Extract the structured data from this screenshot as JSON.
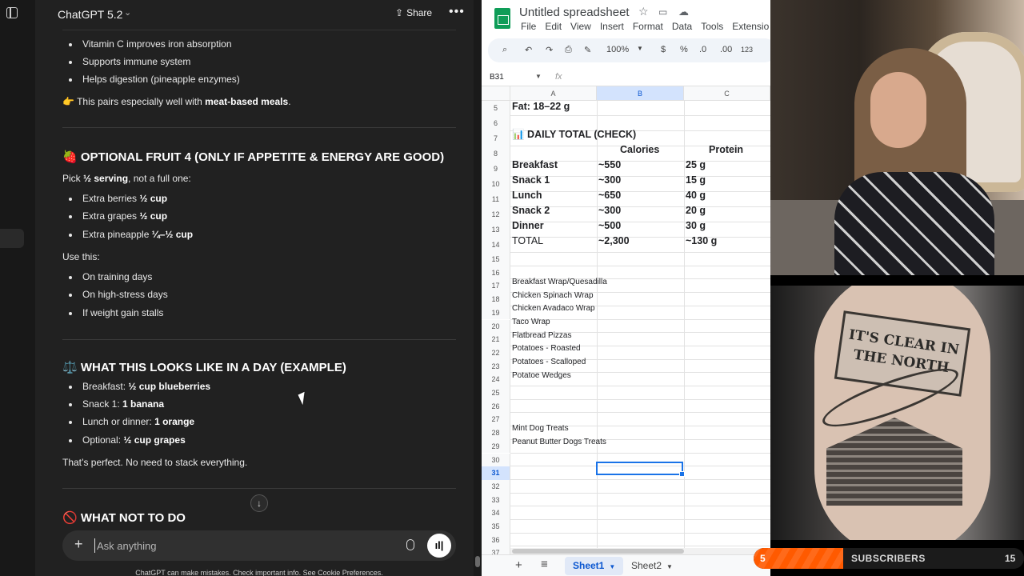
{
  "chatgpt": {
    "model": "ChatGPT 5.2",
    "share": "Share",
    "more": "•••",
    "intro_bullets": [
      "Vitamin C improves iron absorption",
      "Supports immune system",
      "Helps digestion (pineapple enzymes)"
    ],
    "tip_emoji": "👉",
    "tip_text": "This pairs especially well with ",
    "tip_bold": "meat-based meals",
    "tip_end": ".",
    "s1_emoji": "🍓",
    "s1_heading": "OPTIONAL FRUIT 4 (ONLY IF APPETITE & ENERGY ARE GOOD)",
    "s1_pick_a": "Pick ",
    "s1_pick_b": "½ serving",
    "s1_pick_c": ", not a full one:",
    "s1_items": [
      {
        "a": "Extra berries ",
        "b": "½ cup"
      },
      {
        "a": "Extra grapes ",
        "b": "½ cup"
      },
      {
        "a": "Extra pineapple ",
        "b": "¼–½ cup"
      }
    ],
    "use_this": "Use this:",
    "use_items": [
      "On training days",
      "On high-stress days",
      "If weight gain stalls"
    ],
    "s2_emoji": "⚖️",
    "s2_heading": "WHAT THIS LOOKS LIKE IN A DAY (EXAMPLE)",
    "s2_items": [
      {
        "a": "Breakfast: ",
        "b": "½ cup blueberries"
      },
      {
        "a": "Snack 1: ",
        "b": "1 banana"
      },
      {
        "a": "Lunch or dinner: ",
        "b": "1 orange"
      },
      {
        "a": "Optional: ",
        "b": "½ cup grapes"
      }
    ],
    "perfect": "That’s perfect. No need to stack everything.",
    "s3_emoji": "🚫",
    "s3_heading": "WHAT NOT TO DO",
    "input_placeholder": "Ask anything",
    "disclaimer": "ChatGPT can make mistakes. Check important info. See Cookie Preferences."
  },
  "sheets": {
    "title": "Untitled spreadsheet",
    "menu": [
      "File",
      "Edit",
      "View",
      "Insert",
      "Format",
      "Data",
      "Tools",
      "Extensio"
    ],
    "zoom": "100%",
    "currency": "$",
    "percent": "%",
    "dec_less": ".0",
    "dec_more": ".00",
    "num_fmt": "123",
    "name_box": "B31",
    "fx": "fx",
    "columns": [
      "A",
      "B",
      "C"
    ],
    "rows": [
      "5",
      "6",
      "7",
      "8",
      "9",
      "10",
      "11",
      "12",
      "13",
      "14",
      "15",
      "16",
      "17",
      "18",
      "19",
      "20",
      "21",
      "22",
      "23",
      "24",
      "25",
      "26",
      "27",
      "28",
      "29",
      "30",
      "31",
      "32",
      "33",
      "34",
      "35",
      "36",
      "37"
    ],
    "fat": "Fat: 18–22 g",
    "daily_total": "📊 DAILY TOTAL (CHECK)",
    "hdr_cal": "Calories",
    "hdr_pro": "Protein",
    "meals": [
      {
        "name": "Breakfast",
        "cal": "~550",
        "pro": "25 g"
      },
      {
        "name": "Snack 1",
        "cal": "~300",
        "pro": "15 g"
      },
      {
        "name": "Lunch",
        "cal": "~650",
        "pro": "40 g"
      },
      {
        "name": "Snack 2",
        "cal": "~300",
        "pro": "20 g"
      },
      {
        "name": "Dinner",
        "cal": "~500",
        "pro": "30 g"
      },
      {
        "name": "TOTAL",
        "cal": "~2,300",
        "pro": "~130 g"
      }
    ],
    "recipes": [
      "Breakfast Wrap/Quesadilla",
      "Chicken Spinach Wrap",
      "Chicken Avadaco Wrap",
      "Taco Wrap",
      "Flatbread Pizzas",
      "Potatoes - Roasted",
      "Potatoes - Scalloped",
      "Potatoe Wedges"
    ],
    "treats": [
      "Mint Dog Treats",
      "Peanut Butter Dogs Treats"
    ],
    "tabs": [
      "Sheet1",
      "Sheet2"
    ]
  },
  "tattoo": {
    "sign_text": "IT'S CLEAR IN THE NORTH"
  },
  "overlay": {
    "current": "5",
    "label": "SUBSCRIBERS",
    "goal": "15",
    "progress_fraction": 0.33,
    "accent": "#ff6a1a"
  }
}
